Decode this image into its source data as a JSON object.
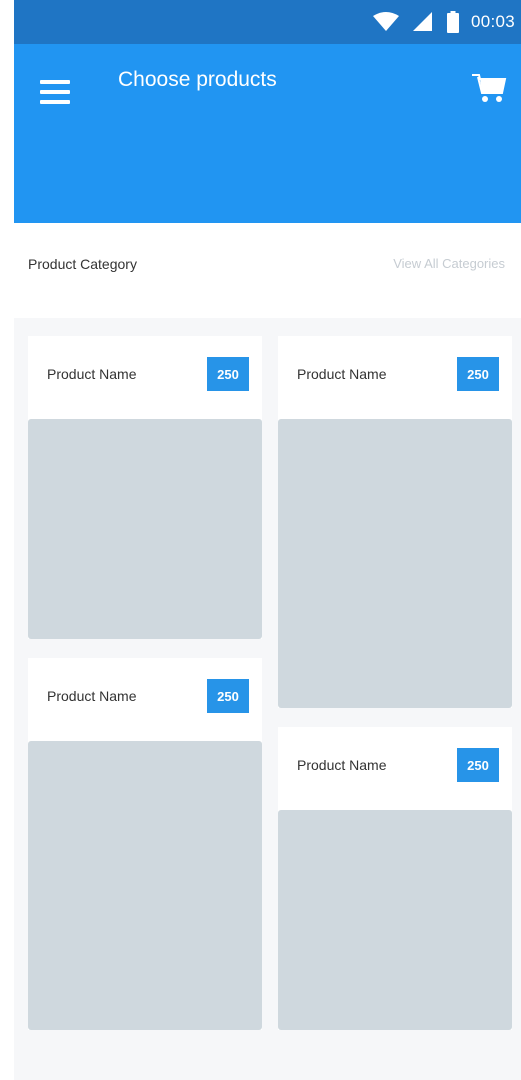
{
  "status_bar": {
    "time": "00:03",
    "icons": [
      "wifi-icon",
      "cellular-signal-icon",
      "battery-icon"
    ]
  },
  "app_bar": {
    "title": "Choose products",
    "menu_icon": "hamburger-menu-icon",
    "cart_icon": "shopping-cart-icon"
  },
  "category": {
    "title": "Product Category",
    "view_all": "View All Categories"
  },
  "products": [
    {
      "name": "Product Name",
      "price": "250"
    },
    {
      "name": "Product Name",
      "price": "250"
    },
    {
      "name": "Product Name",
      "price": "250"
    },
    {
      "name": "Product Name",
      "price": "250"
    }
  ],
  "colors": {
    "status_bar": "#1f75c4",
    "app_bar": "#2195f2",
    "badge": "#2794e8",
    "image_placeholder": "#cfd8de",
    "background": "#f6f7f9"
  }
}
